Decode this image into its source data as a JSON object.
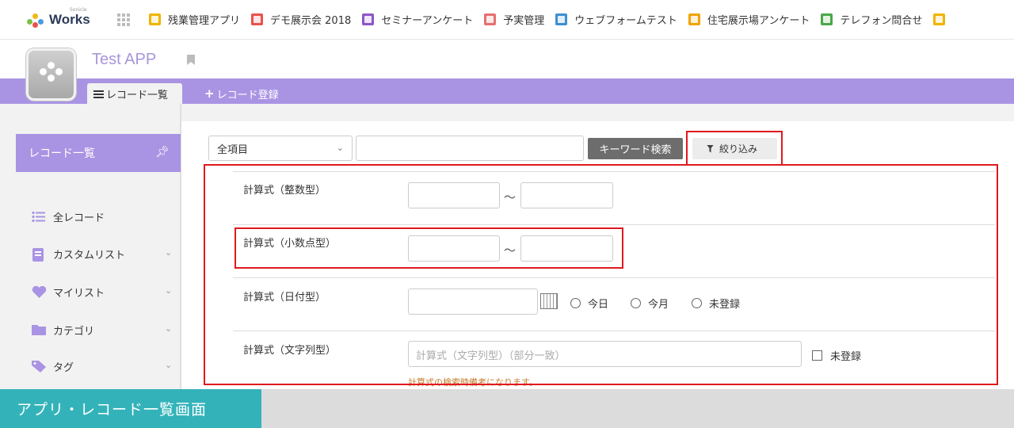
{
  "brand": {
    "small_label": "Sonicle",
    "name": "Works",
    "colors": [
      "#7ac143",
      "#f1b818",
      "#4b9be0",
      "#e8524a"
    ]
  },
  "apps_bar": [
    {
      "label": "残業管理アプリ",
      "color": "#f0b400",
      "icon": "check-app-icon"
    },
    {
      "label": "デモ展示会 2018",
      "color": "#e8524a",
      "icon": "document-app-icon"
    },
    {
      "label": "セミナーアンケート",
      "color": "#8d55c9",
      "icon": "document-app-icon"
    },
    {
      "label": "予実管理",
      "color": "#e76f6f",
      "icon": "chart-app-icon"
    },
    {
      "label": "ウェブフォームテスト",
      "color": "#3d8fd1",
      "icon": "form-app-icon"
    },
    {
      "label": "住宅展示場アンケート",
      "color": "#f0a400",
      "icon": "form-app-icon"
    },
    {
      "label": "テレフォン問合せ",
      "color": "#4aa84a",
      "icon": "question-app-icon"
    }
  ],
  "app": {
    "title": "Test APP"
  },
  "tabs": {
    "list": "レコード一覧",
    "add": "レコード登録"
  },
  "sidebar": {
    "header": "レコード一覧",
    "items": [
      {
        "label": "全レコード",
        "icon": "list-icon",
        "color": "#a994e3"
      },
      {
        "label": "カスタムリスト",
        "icon": "book-icon",
        "color": "#a994e3"
      },
      {
        "label": "マイリスト",
        "icon": "heart-icon",
        "color": "#a994e3"
      },
      {
        "label": "カテゴリ",
        "icon": "folder-icon",
        "color": "#a994e3"
      },
      {
        "label": "タグ",
        "icon": "tag-icon",
        "color": "#a994e3"
      }
    ]
  },
  "search": {
    "scope": "全項目",
    "keyword_value": "",
    "keyword_button": "キーワード検索",
    "filter_button": "絞り込み"
  },
  "filters": [
    {
      "label": "計算式（整数型）"
    },
    {
      "label": "計算式（小数点型）"
    },
    {
      "label": "計算式（日付型）"
    },
    {
      "label": "計算式（文字列型）"
    }
  ],
  "tilde": "〜",
  "date_options": [
    "今日",
    "今月",
    "未登録"
  ],
  "string_filter": {
    "placeholder": "計算式（文字列型）（部分一致）",
    "unregistered": "未登録",
    "note": "計算式の検索時備考になります。"
  },
  "highlight_color": "#e0191f",
  "caption": "アプリ・レコード一覧画面"
}
